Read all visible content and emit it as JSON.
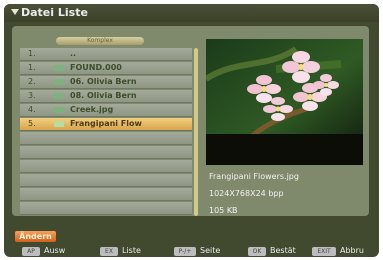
{
  "window": {
    "title": "Datei Liste"
  },
  "list": {
    "header_button": "Komplex",
    "rows": [
      {
        "num": "1.",
        "name": "..",
        "selected": false
      },
      {
        "num": "1.",
        "name": "FOUND.000",
        "selected": false
      },
      {
        "num": "2.",
        "name": "06. Olivia Bern",
        "selected": false
      },
      {
        "num": "3.",
        "name": "08. Olivia Bern",
        "selected": false
      },
      {
        "num": "4.",
        "name": "Creek.jpg",
        "selected": false
      },
      {
        "num": "5.",
        "name": "Frangipani Flow",
        "selected": true
      },
      {
        "num": "",
        "name": "",
        "selected": false
      },
      {
        "num": "",
        "name": "",
        "selected": false
      },
      {
        "num": "",
        "name": "",
        "selected": false
      },
      {
        "num": "",
        "name": "",
        "selected": false
      },
      {
        "num": "",
        "name": "",
        "selected": false
      },
      {
        "num": "",
        "name": "",
        "selected": false
      }
    ]
  },
  "details": {
    "filename": "Frangipani Flowers.jpg",
    "resolution": "1024X768X24 bpp",
    "size": "105 KB"
  },
  "actions": {
    "andern": "Ändern"
  },
  "footer": {
    "keys": [
      {
        "key": "AP",
        "label": "Ausw"
      },
      {
        "key": "EX",
        "label": "Liste"
      },
      {
        "key": "P-/+",
        "label": "Seite"
      },
      {
        "key": "OK",
        "label": "Bestät"
      },
      {
        "key": "EXIT",
        "label": "Abbru"
      }
    ]
  },
  "colors": {
    "background": "#41492e",
    "panel": "#7f896b",
    "selected_row": "#e2b55e",
    "accent_orange": "#e27b34"
  }
}
